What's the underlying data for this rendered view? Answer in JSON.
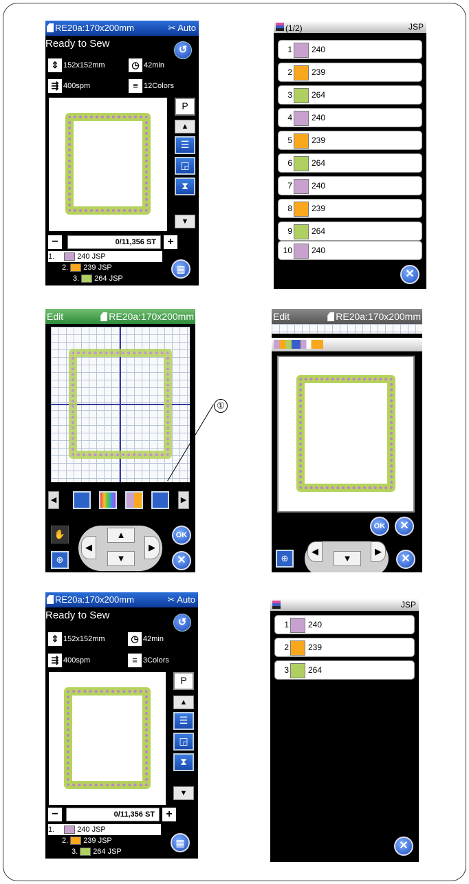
{
  "colors": {
    "lavender": "#c8a2cf",
    "orange": "#f9a71d",
    "green": "#afd060",
    "accent": "#1f55c5"
  },
  "screen_sew_1": {
    "hoop": "RE20a:170x200mm",
    "auto": "Auto",
    "status": "Ready to Sew",
    "size": "152x152mm",
    "time": "42min",
    "speed": "400spm",
    "colors": "12Colors",
    "stitch_count": "0/11,356 ST",
    "color_list": [
      {
        "num": "1.",
        "label": "240 JSP"
      },
      {
        "num": "2.",
        "label": "239 JSP"
      },
      {
        "num": "3.",
        "label": "264 JSP"
      }
    ]
  },
  "screen_list_1": {
    "page": "(1/2)",
    "brand": "JSP",
    "items": [
      {
        "n": "1",
        "code": "240",
        "color": "lavender"
      },
      {
        "n": "2",
        "code": "239",
        "color": "orange"
      },
      {
        "n": "3",
        "code": "264",
        "color": "green"
      },
      {
        "n": "4",
        "code": "240",
        "color": "lavender"
      },
      {
        "n": "5",
        "code": "239",
        "color": "orange"
      },
      {
        "n": "6",
        "code": "264",
        "color": "green"
      },
      {
        "n": "7",
        "code": "240",
        "color": "lavender"
      },
      {
        "n": "8",
        "code": "239",
        "color": "orange"
      },
      {
        "n": "9",
        "code": "264",
        "color": "green"
      },
      {
        "n": "10",
        "code": "240",
        "color": "lavender"
      }
    ]
  },
  "screen_edit": {
    "title": "Edit",
    "hoop": "RE20a:170x200mm",
    "callout": "①"
  },
  "screen_edit_dialog": {
    "title": "Edit",
    "hoop": "RE20a:170x200mm"
  },
  "screen_sew_2": {
    "hoop": "RE20a:170x200mm",
    "auto": "Auto",
    "status": "Ready to Sew",
    "size": "152x152mm",
    "time": "42min",
    "speed": "400spm",
    "colors": "3Colors",
    "stitch_count": "0/11,356 ST",
    "color_list": [
      {
        "num": "1.",
        "label": "240 JSP"
      },
      {
        "num": "2.",
        "label": "239 JSP"
      },
      {
        "num": "3.",
        "label": "264 JSP"
      }
    ]
  },
  "screen_list_2": {
    "brand": "JSP",
    "items": [
      {
        "n": "1",
        "code": "240",
        "color": "lavender"
      },
      {
        "n": "2",
        "code": "239",
        "color": "orange"
      },
      {
        "n": "3",
        "code": "264",
        "color": "green"
      }
    ]
  },
  "icons": {
    "back": "↺",
    "clock": "◷",
    "presser": "P",
    "up": "▲",
    "down": "▼",
    "left": "◀",
    "right": "▶",
    "plus": "+",
    "minus": "−",
    "close": "✕",
    "ok": "OK",
    "zoom": "⊕",
    "grid": "▦",
    "hand": "✋"
  }
}
